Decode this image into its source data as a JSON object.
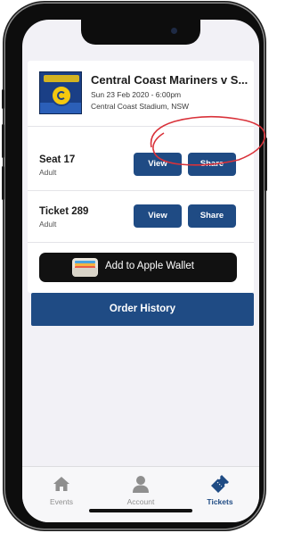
{
  "event": {
    "title": "Central Coast Mariners v S...",
    "date": "Sun 23 Feb 2020 - 6:00pm",
    "venue": "Central Coast Stadium, NSW"
  },
  "tickets": [
    {
      "name": "Seat 17",
      "type": "Adult",
      "view_label": "View",
      "share_label": "Share"
    },
    {
      "name": "Ticket 289",
      "type": "Adult",
      "view_label": "View",
      "share_label": "Share"
    }
  ],
  "wallet": {
    "label": "Add to Apple Wallet"
  },
  "order_history": {
    "label": "Order History"
  },
  "tabs": [
    {
      "label": "Events",
      "icon": "home-icon",
      "active": false
    },
    {
      "label": "Account",
      "icon": "person-icon",
      "active": false
    },
    {
      "label": "Tickets",
      "icon": "ticket-icon",
      "active": true
    }
  ],
  "colors": {
    "accent": "#1f4b84",
    "annotation": "#d9323a",
    "background": "#f2f1f6"
  }
}
